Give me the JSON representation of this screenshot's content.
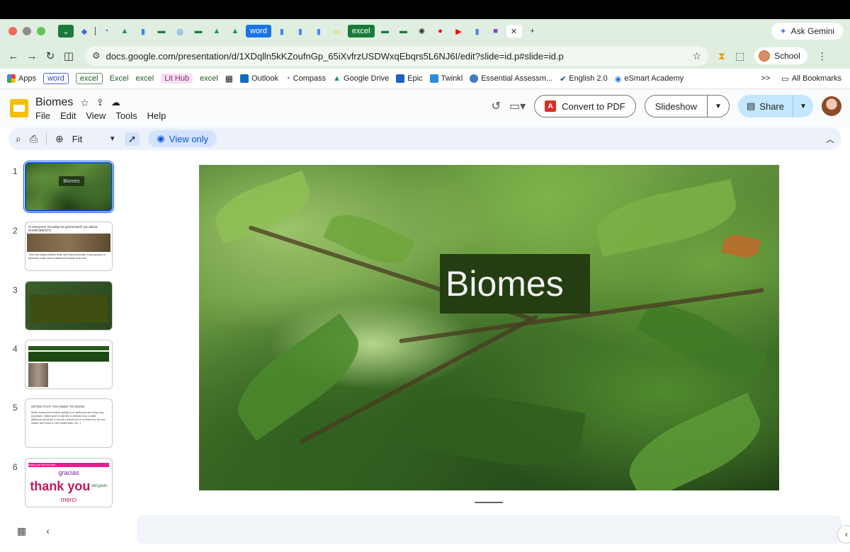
{
  "browser": {
    "tab_pills": [
      "word",
      "excel"
    ],
    "gemini_label": "Ask Gemini",
    "url": "docs.google.com/presentation/d/1XDqlln5kKZoufnGp_65iXvfrzUSDWxqEbqrs5L6NJ6I/edit?slide=id.p#slide=id.p",
    "profile_label": "School",
    "bookmarks": [
      "Apps",
      "word",
      "excel",
      "Excel",
      "excel",
      "Lit Hub",
      "excel",
      "Outlook",
      "Compass",
      "Google Drive",
      "Epic",
      "Twinkl",
      "Essential Assessm...",
      "English 2.0",
      "eSmart Academy"
    ],
    "all_bookmarks": "All Bookmarks",
    "bookmarks_more": ">>"
  },
  "doc": {
    "title": "Biomes",
    "menus": [
      "File",
      "Edit",
      "View",
      "Tools",
      "Help"
    ],
    "convert_pdf": "Convert to PDF",
    "slideshow": "Slideshow",
    "share": "Share"
  },
  "toolbar": {
    "zoom": "Fit",
    "view_only": "View only"
  },
  "filmstrip": {
    "numbers": [
      "1",
      "2",
      "3",
      "4",
      "5",
      "6"
    ],
    "t1_title": "Biomes",
    "t2_heading": "Hi everyone! So today im gonna teach you about RAINFORESTS",
    "t2_body": "There are heaps creative birds, and tropical animals. If your going to a rainforest, make sure to admire the beauty from a far.",
    "t5_heading": "NOTES THAT YOU NEED TO KNOW",
    "t5_body": "Wear sunscreen before going to a rainforest and stay bug repellant, make sure to admire a animal from a safe distance because it can be poisonous or venomous, do not shake any trees in the rainforests, etc :)",
    "t6_bar": "thank you for the help",
    "t6_words": [
      "gracias",
      "thank you",
      "obrigado",
      "merci"
    ]
  },
  "slide": {
    "title": "Biomes"
  }
}
